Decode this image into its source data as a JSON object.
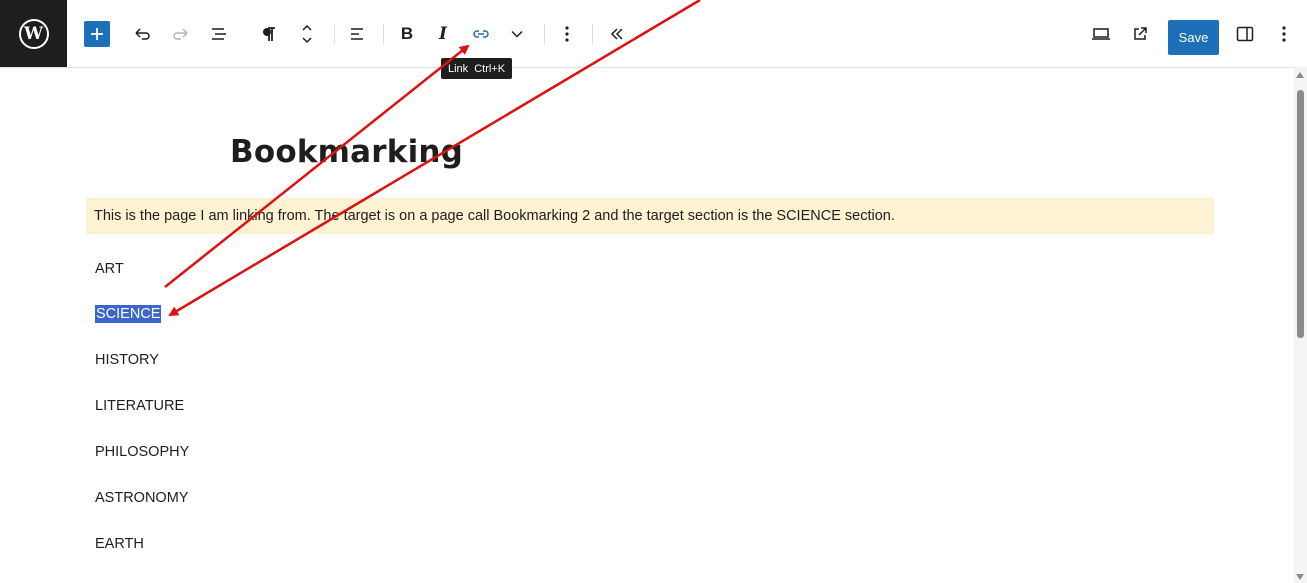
{
  "toolbar": {
    "logo_glyph": "W",
    "tooltip_label": "Link",
    "tooltip_shortcut": "Ctrl+K",
    "save_label": "Save",
    "icons": [
      "wordpress-logo",
      "add-block",
      "undo",
      "redo",
      "document-overview",
      "paragraph",
      "move-up-down",
      "align",
      "bold",
      "italic",
      "link",
      "more-options-chevron",
      "options",
      "collapse",
      "preview-desktop",
      "view-external",
      "save",
      "settings-sidebar",
      "more-menu"
    ],
    "accent_color": "#1d70b8"
  },
  "content": {
    "title": "Bookmarking",
    "intro": "This is the page I am linking from. The target is on a page call Bookmarking 2 and the target section is the SCIENCE section.",
    "intro_background": "#fdf3d3",
    "items": [
      {
        "label": "ART",
        "selected": false
      },
      {
        "label": "SCIENCE",
        "selected": true
      },
      {
        "label": "HISTORY",
        "selected": false
      },
      {
        "label": "LITERATURE",
        "selected": false
      },
      {
        "label": "PHILOSOPHY",
        "selected": false
      },
      {
        "label": "ASTRONOMY",
        "selected": false
      },
      {
        "label": "EARTH",
        "selected": false
      }
    ],
    "selection_color": "#3a67c9"
  },
  "annotations": {
    "arrow_color": "#e01010"
  }
}
